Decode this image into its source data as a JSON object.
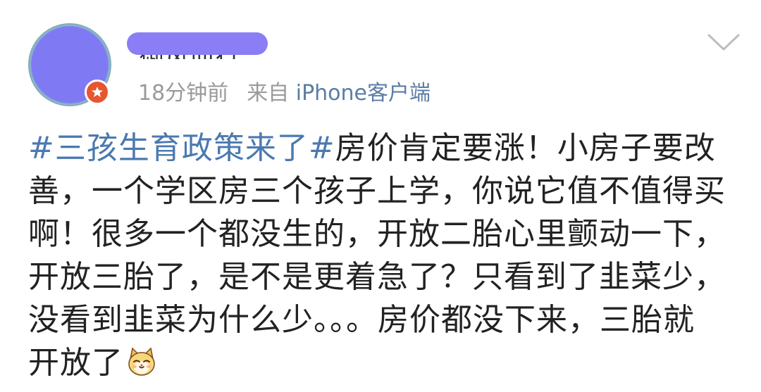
{
  "post": {
    "username": "御风而行",
    "time": "18分钟前",
    "source_prefix": "来自",
    "source": "iPhone客户端",
    "hashtag": "#三孩生育政策来了#",
    "content_lines": [
      "房价肯定要涨！小房子要改",
      "善，一个学区房三个孩子上学，你说它值不值得买",
      "啊！很多一个都没生的，开放二胎心里颤动一下，",
      "开放三胎了，是不是更着急了？只看到了韭菜少，",
      "没看到韭菜为什么少。。。房价都没下来，三胎就",
      "开放了"
    ],
    "icons": {
      "avatar_badge": "verified-badge-icon",
      "menu": "chevron-down-icon",
      "emoji": "cat-face-emoji-icon"
    },
    "colors": {
      "hashtag": "#4b79b0",
      "source": "#5b7ca6",
      "meta": "#9a9a9a",
      "text": "#222222",
      "badge": "#e8552f"
    }
  }
}
